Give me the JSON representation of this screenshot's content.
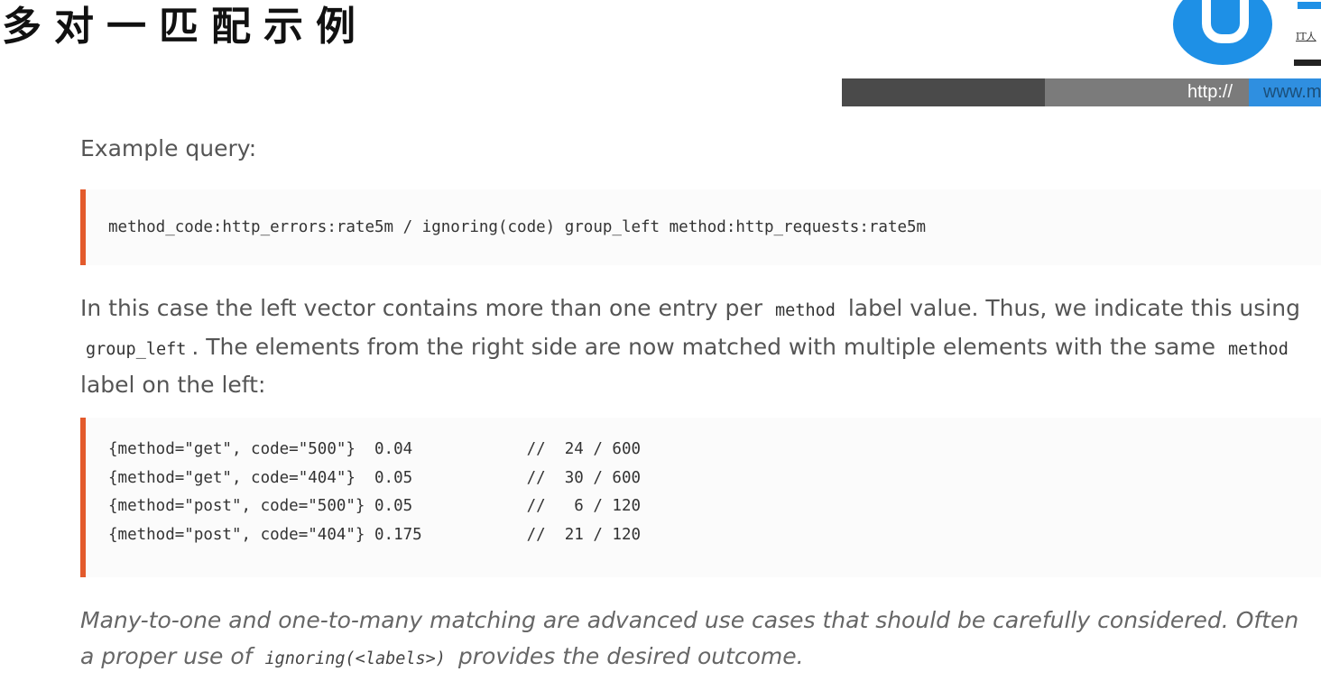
{
  "slide": {
    "title": "多对一匹配示例"
  },
  "logo": {
    "text": "IT人"
  },
  "url_bar": {
    "protocol": "http://",
    "domain": "www.m"
  },
  "doc": {
    "example_label": "Example query:",
    "query": "method_code:http_errors:rate5m / ignoring(code) group_left method:http_requests:rate5m",
    "explanation": {
      "part1": "In this case the left vector contains more than one entry per",
      "code1": "method",
      "part2": "label value. Thus, we indicate this using",
      "code2": "group_left",
      "part3": ". The elements from the right side are now matched with multiple elements with the same",
      "code3": "method",
      "part4": "label on the left:"
    },
    "result_lines": [
      "{method=\"get\", code=\"500\"}  0.04            //  24 / 600",
      "{method=\"get\", code=\"404\"}  0.05            //  30 / 600",
      "{method=\"post\", code=\"500\"} 0.05            //   6 / 120",
      "{method=\"post\", code=\"404\"} 0.175           //  21 / 120"
    ],
    "note": {
      "part1": "Many-to-one and one-to-many matching are advanced use cases that should be carefully considered. Often a proper use of",
      "code": "ignoring(<labels>)",
      "part2": "provides the desired outcome."
    }
  },
  "colors": {
    "accent_border": "#e35a2c",
    "logo_blue": "#1e90e6"
  }
}
